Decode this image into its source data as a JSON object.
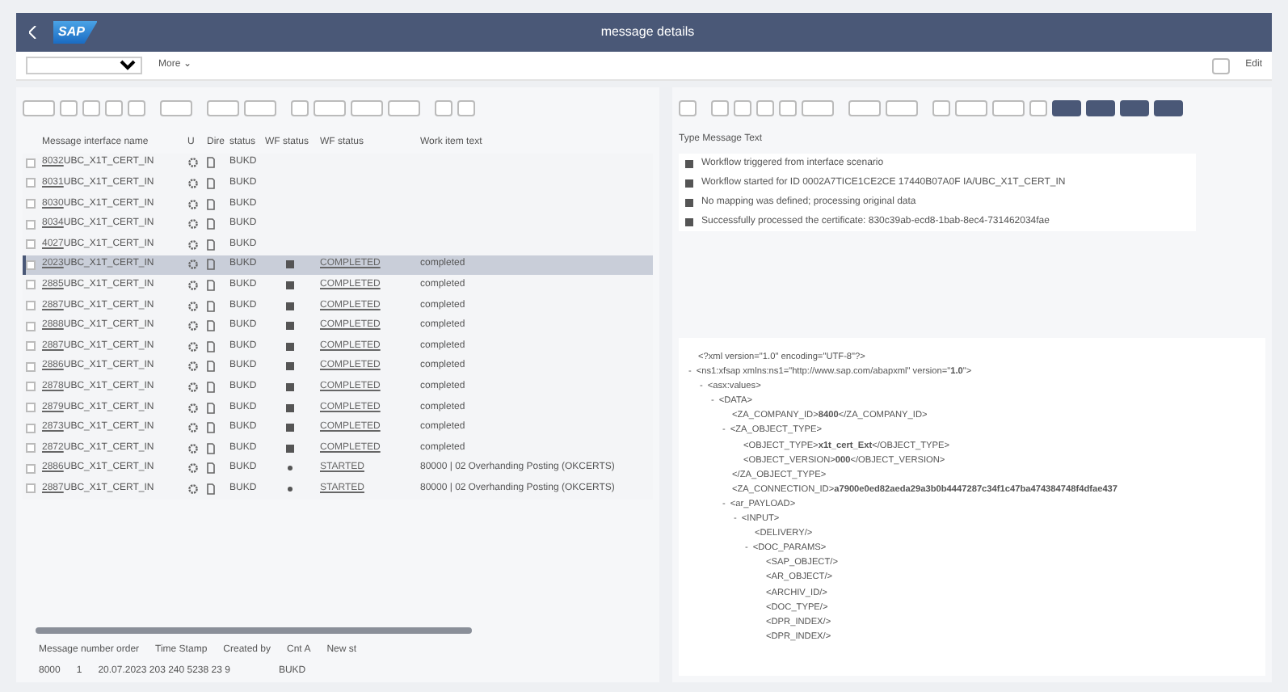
{
  "header": {
    "logo": "SAP",
    "title": "message details"
  },
  "toolbar": {
    "more": "More ⌄",
    "edit": "Edit"
  },
  "left_table": {
    "columns": [
      "Message interface name",
      "U",
      "Dire",
      "status",
      "WF status",
      "WF status",
      "Work item text"
    ],
    "rows": [
      {
        "id": "8032",
        "name": "UBC_X1T_CERT_IN",
        "status": "BUKD",
        "selected": false
      },
      {
        "id": "8031",
        "name": "UBC_X1T_CERT_IN",
        "status": "BUKD",
        "selected": false
      },
      {
        "id": "8030",
        "name": "UBC_X1T_CERT_IN",
        "status": "BUKD",
        "selected": false
      },
      {
        "id": "8034",
        "name": "UBC_X1T_CERT_IN",
        "status": "BUKD",
        "selected": false
      },
      {
        "id": "4027",
        "name": "UBC_X1T_CERT_IN",
        "status": "BUKD",
        "selected": false
      },
      {
        "id": "2023",
        "name": "UBC_X1T_CERT_IN",
        "status": "BUKD",
        "selected": true,
        "wf": {
          "kind": "completed",
          "code": "COMPLETED",
          "text": "completed"
        }
      },
      {
        "id": "2885",
        "name": "UBC_X1T_CERT_IN",
        "status": "BUKD",
        "selected": false,
        "wf": {
          "kind": "completed",
          "code": "COMPLETED",
          "text": "completed"
        }
      },
      {
        "id": "2887",
        "name": "UBC_X1T_CERT_IN",
        "status": "BUKD",
        "selected": false,
        "wf": {
          "kind": "completed",
          "code": "COMPLETED",
          "text": "completed"
        }
      },
      {
        "id": "2888",
        "name": "UBC_X1T_CERT_IN",
        "status": "BUKD",
        "selected": false,
        "wf": {
          "kind": "completed",
          "code": "COMPLETED",
          "text": "completed"
        }
      },
      {
        "id": "2887",
        "name": "UBC_X1T_CERT_IN",
        "status": "BUKD",
        "selected": false,
        "wf": {
          "kind": "completed",
          "code": "COMPLETED",
          "text": "completed"
        }
      },
      {
        "id": "2886",
        "name": "UBC_X1T_CERT_IN",
        "status": "BUKD",
        "selected": false,
        "wf": {
          "kind": "completed",
          "code": "COMPLETED",
          "text": "completed"
        }
      },
      {
        "id": "2878",
        "name": "UBC_X1T_CERT_IN",
        "status": "BUKD",
        "selected": false,
        "wf": {
          "kind": "completed",
          "code": "COMPLETED",
          "text": "completed"
        }
      },
      {
        "id": "2879",
        "name": "UBC_X1T_CERT_IN",
        "status": "BUKD",
        "selected": false,
        "wf": {
          "kind": "completed",
          "code": "COMPLETED",
          "text": "completed"
        }
      },
      {
        "id": "2873",
        "name": "UBC_X1T_CERT_IN",
        "status": "BUKD",
        "selected": false,
        "wf": {
          "kind": "completed",
          "code": "COMPLETED",
          "text": "completed"
        }
      },
      {
        "id": "2872",
        "name": "UBC_X1T_CERT_IN",
        "status": "BUKD",
        "selected": false,
        "wf": {
          "kind": "completed",
          "code": "COMPLETED",
          "text": "completed"
        }
      },
      {
        "id": "2886",
        "name": "UBC_X1T_CERT_IN",
        "status": "BUKD",
        "selected": false,
        "wf": {
          "kind": "started",
          "code": "STARTED",
          "text": "80000 | 02",
          "work_item": "Overhanding Posting (OKCERTS)"
        }
      },
      {
        "id": "2887",
        "name": "UBC_X1T_CERT_IN",
        "status": "BUKD",
        "selected": false,
        "wf": {
          "kind": "started",
          "code": "STARTED",
          "text": "80000 | 02",
          "work_item": "Overhanding Posting (OKCERTS)"
        }
      }
    ]
  },
  "bottom_table": {
    "columns": [
      "Message number order",
      "Time Stamp",
      "Created by",
      "Cnt A",
      "New st"
    ],
    "row": [
      "8000",
      "1",
      "20.07.2023 203 240 5238 23 9",
      "BUKD"
    ]
  },
  "messages": {
    "header": "Type Message Text",
    "rows": [
      "Workflow triggered from interface scenario",
      "Workflow started for ID 0002A7TICE1CE2CE 17440B07A0F IA/UBC_X1T_CERT_IN",
      "No mapping was defined; processing original data",
      "Successfully processed the certificate: 830c39ab-ecd8-1bab-8ec4-731462034fae"
    ]
  },
  "xml": [
    {
      "text": "<?xml version=\"1.0\" encoding=\"UTF-8\"?>"
    },
    {
      "toggle": "-",
      "text": "<ns1:xfsap xmlns:ns1=\"http://www.sap.com/abapxml\" version=\"**1.0**\">",
      "children": [
        {
          "toggle": "-",
          "text": "<asx:values>",
          "children": [
            {
              "toggle": "-",
              "text": "<DATA>",
              "children": [
                {
                  "text": "<ZA_COMPANY_ID>**8400**</ZA_COMPANY_ID>"
                },
                {
                  "toggle": "-",
                  "text": "<ZA_OBJECT_TYPE>",
                  "children": [
                    {
                      "text": "<OBJECT_TYPE>**x1t_cert_Ext**</OBJECT_TYPE>"
                    },
                    {
                      "text": "<OBJECT_VERSION>**000**</OBJECT_VERSION>"
                    }
                  ]
                },
                {
                  "text": "</ZA_OBJECT_TYPE>"
                },
                {
                  "text": "<ZA_CONNECTION_ID>**a7900e0ed82aeda29a3b0b4447287c34f1c47ba474384748f4dfae437**"
                },
                {
                  "toggle": "-",
                  "text": "<ar_PAYLOAD>",
                  "children": [
                    {
                      "toggle": "-",
                      "text": "<INPUT>",
                      "children": [
                        {
                          "text": "<DELIVERY/>"
                        },
                        {
                          "toggle": "-",
                          "text": "<DOC_PARAMS>",
                          "children": [
                            {
                              "text": "<SAP_OBJECT/>"
                            },
                            {
                              "text": "<AR_OBJECT/>"
                            },
                            {
                              "text": "<ARCHIV_ID/>"
                            },
                            {
                              "text": "<DOC_TYPE/>"
                            },
                            {
                              "text": "<DPR_INDEX/>"
                            },
                            {
                              "text": "<DPR_INDEX/>"
                            }
                          ]
                        }
                      ]
                    }
                  ]
                }
              ]
            }
          ]
        }
      ]
    }
  ]
}
